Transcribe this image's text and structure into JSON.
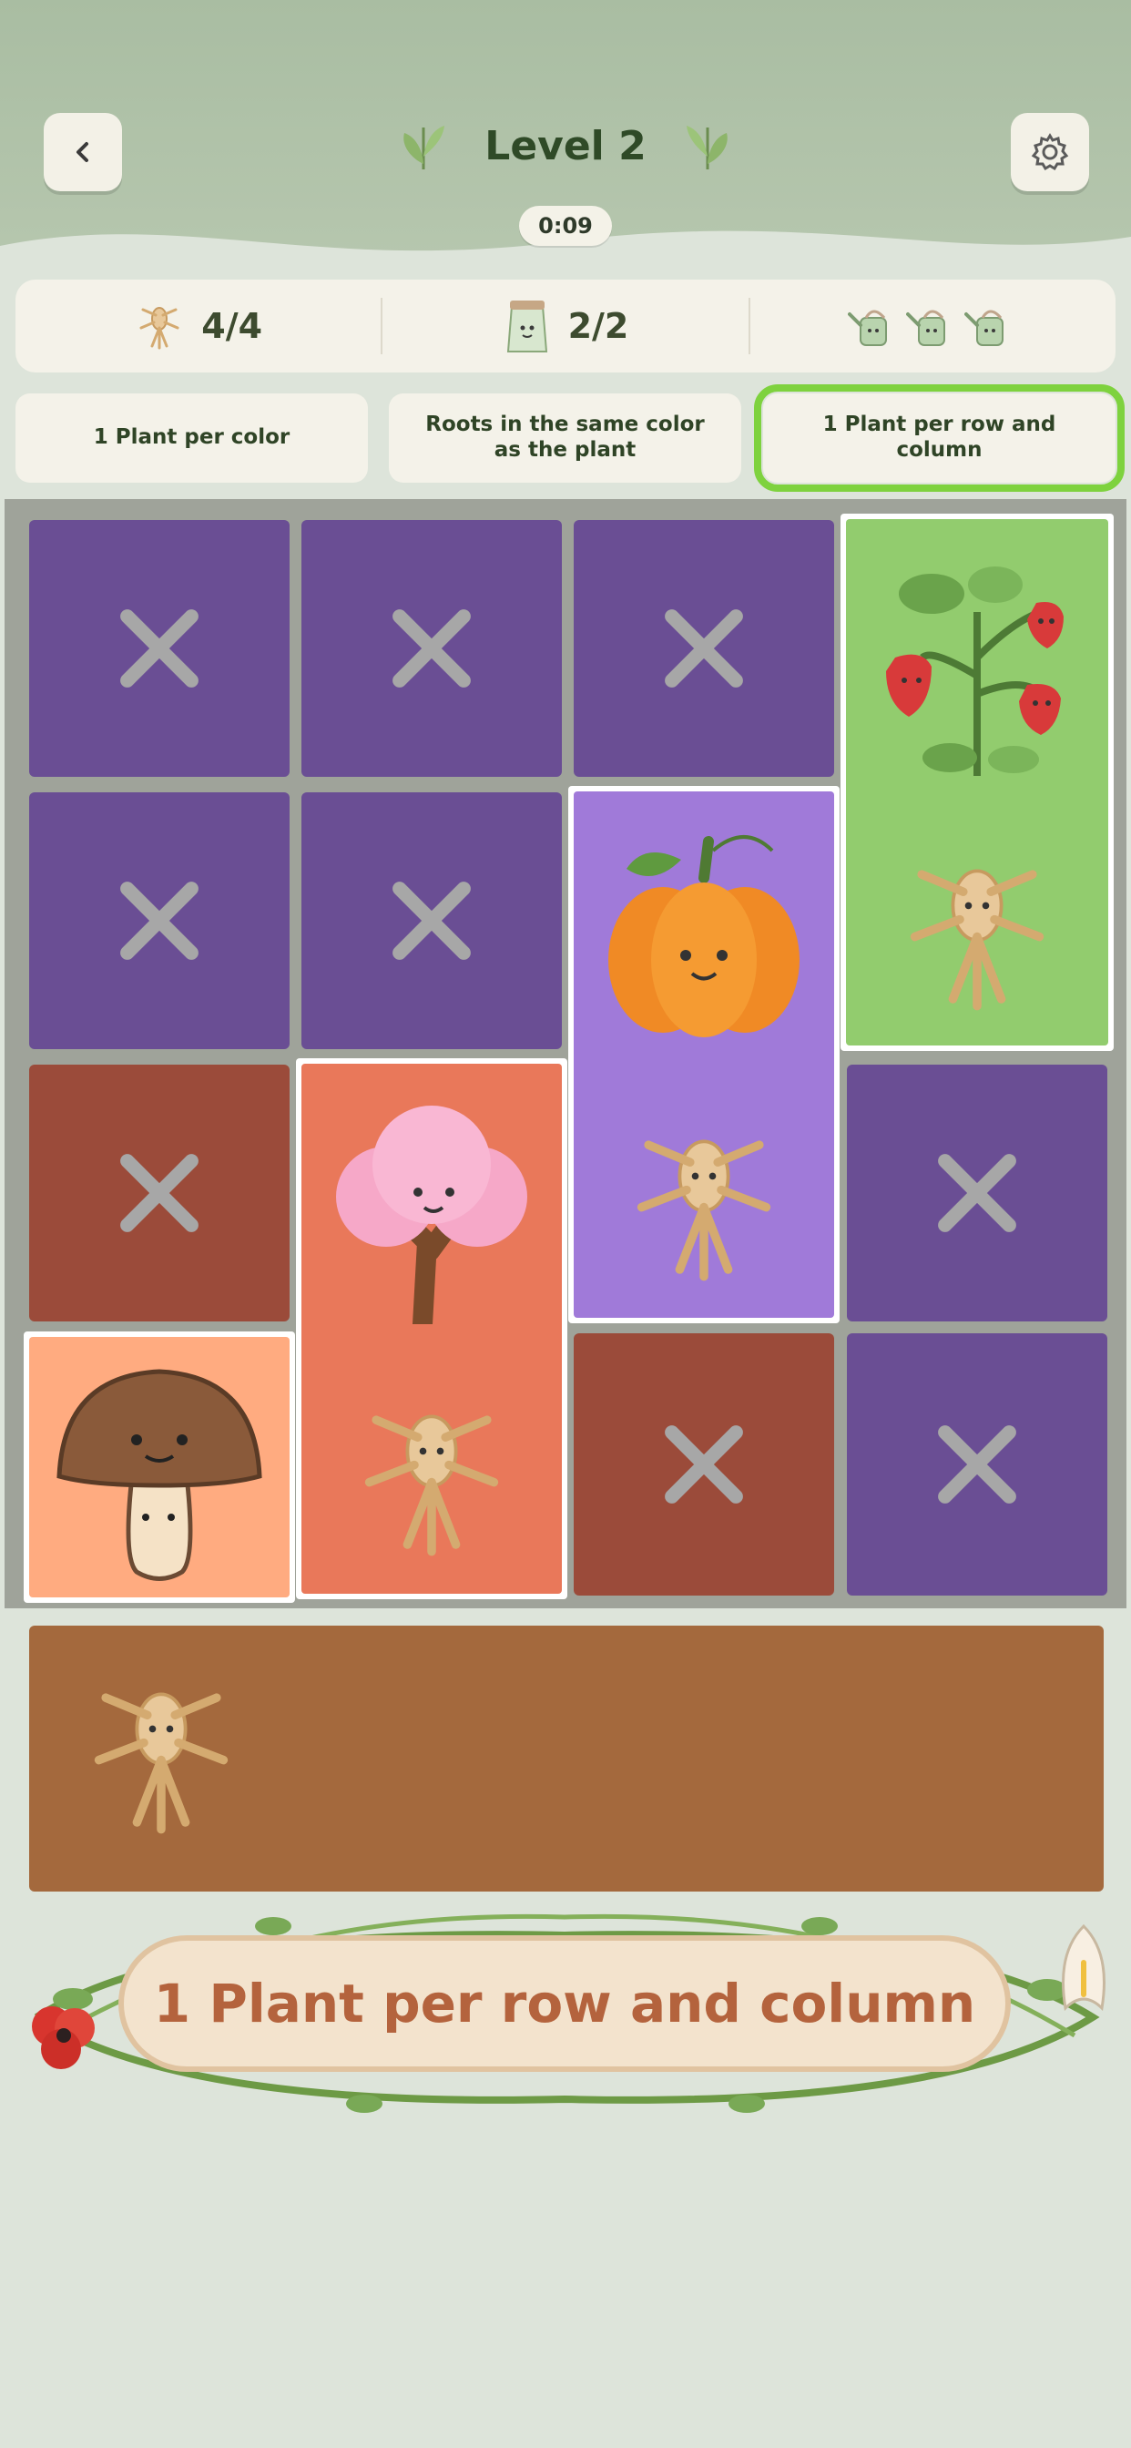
{
  "header": {
    "back_icon": "chevron-left-icon",
    "title": "Level 2",
    "settings_icon": "gear-icon",
    "timer": "0:09"
  },
  "stats": {
    "roots": "4/4",
    "seed_bags": "2/2",
    "watering_cans_remaining": 3
  },
  "rules": [
    {
      "label": "1 Plant per color",
      "active": false
    },
    {
      "label": "Roots in the same color as the plant",
      "active": false
    },
    {
      "label": "1 Plant per row and column",
      "active": true
    }
  ],
  "board": {
    "rows": 4,
    "cols": 4,
    "plants": [
      "strawberry",
      "pumpkin",
      "cherry-blossom-tree",
      "mushroom"
    ],
    "crossed_cells": 9
  },
  "tray": {
    "items": [
      "root"
    ]
  },
  "banner": {
    "text": "1 Plant per row and column"
  },
  "colors": {
    "purple": "#6a4e94",
    "light_purple": "#a07ad9",
    "brown_red": "#9b4b3a",
    "orange": "#e9785a",
    "peach": "#ffab80",
    "green": "#92cc6e",
    "tray": "#a4693d",
    "active_outline": "#7ed23e"
  }
}
